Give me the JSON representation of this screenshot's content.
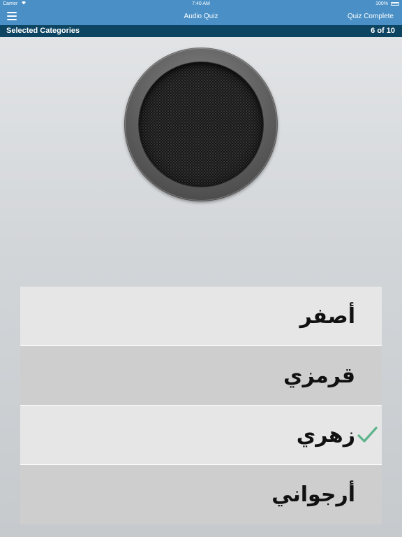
{
  "status_bar": {
    "carrier": "Carrier",
    "time": "7:40 AM",
    "battery": "100%"
  },
  "nav": {
    "title": "Audio Quiz",
    "quiz_complete": "Quiz Complete",
    "menu_icon": "hamburger-menu-icon"
  },
  "sub_header": {
    "categories": "Selected Categories",
    "progress": "6 of 10"
  },
  "speaker": {
    "icon": "speaker-icon"
  },
  "answers": [
    {
      "text": "أصفر",
      "correct": false
    },
    {
      "text": "قرمزي",
      "correct": false
    },
    {
      "text": "زهري",
      "correct": true
    },
    {
      "text": "أرجواني",
      "correct": false
    }
  ],
  "colors": {
    "nav_blue": "#4a90c6",
    "sub_header_navy": "#0c4462",
    "check_green": "#5db38a"
  }
}
